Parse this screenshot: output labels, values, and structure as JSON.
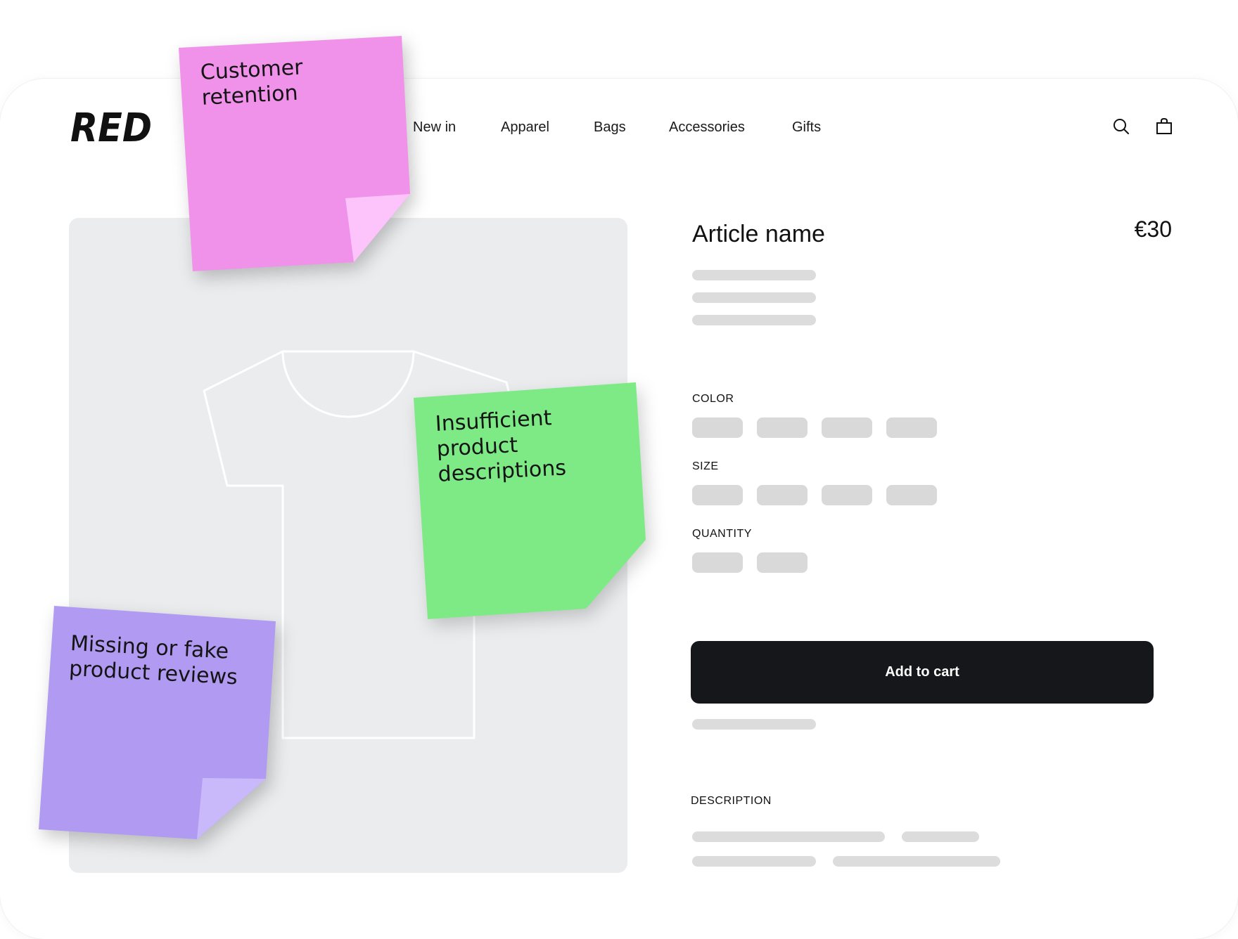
{
  "brand": {
    "logo_text": "RED"
  },
  "nav": {
    "items": [
      {
        "label": "New in"
      },
      {
        "label": "Apparel"
      },
      {
        "label": "Bags"
      },
      {
        "label": "Accessories"
      },
      {
        "label": "Gifts"
      }
    ]
  },
  "header_icons": {
    "search": "search-icon",
    "cart": "shopping-bag-icon"
  },
  "product": {
    "title": "Article name",
    "price": "€30",
    "color_label": "COLOR",
    "size_label": "SIZE",
    "quantity_label": "QUANTITY",
    "add_to_cart_label": "Add to cart",
    "description_label": "DESCRIPTION"
  },
  "sticky_notes": [
    {
      "text": "Customer\nretention",
      "color": "#f092ea"
    },
    {
      "text": "Insufficient\nproduct\ndescriptions",
      "color": "#7eea86"
    },
    {
      "text": "Missing or fake\nproduct reviews",
      "color": "#b09af2"
    }
  ],
  "colors": {
    "cta_background": "#15171a",
    "placeholder": "#dcdcdc",
    "image_background": "#ebecee"
  }
}
